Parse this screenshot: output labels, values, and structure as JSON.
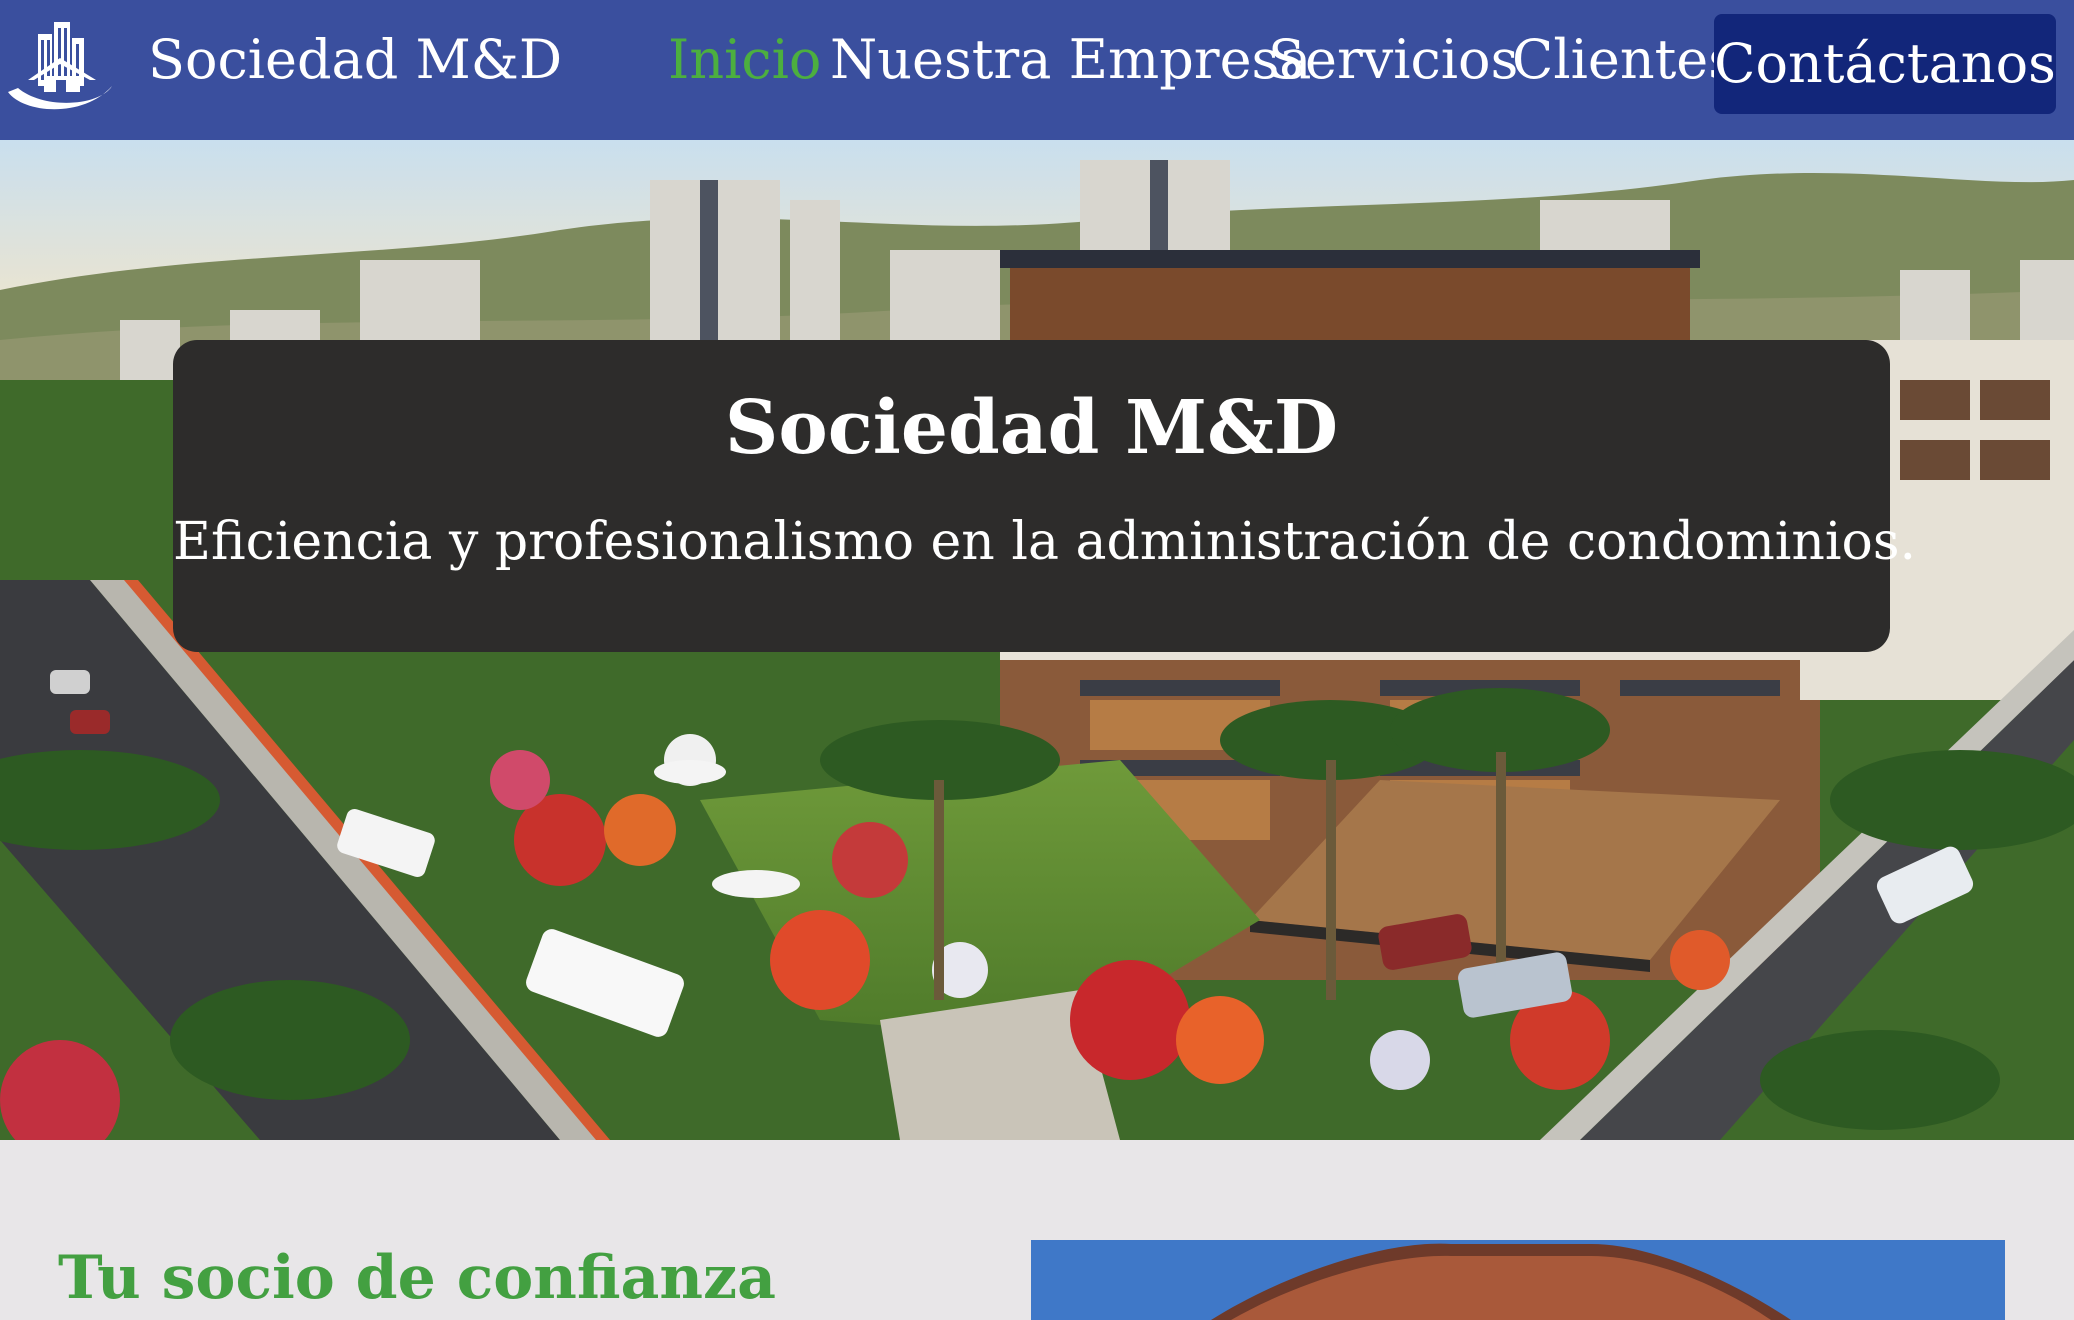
{
  "header": {
    "brand": "Sociedad M&D",
    "logo_icon": "building-house-logo-icon",
    "nav": [
      {
        "label": "Inicio",
        "active": true
      },
      {
        "label": "Nuestra Empresa",
        "active": false
      },
      {
        "label": "Servicios",
        "active": false
      },
      {
        "label": "Clientes",
        "active": false
      }
    ],
    "cta_label": "Contáctanos"
  },
  "hero": {
    "title": "Sociedad M&D",
    "subtitle": "Eficiencia y profesionalismo en la administración de condominios."
  },
  "section": {
    "title": "Tu socio de confianza"
  },
  "colors": {
    "header_bg": "#3a4f9e",
    "nav_active": "#4caf3f",
    "cta_bg": "#12267a",
    "hero_card_bg": "#2d2c2b",
    "section_title": "#43a041",
    "page_bg": "#e8e6e8"
  }
}
